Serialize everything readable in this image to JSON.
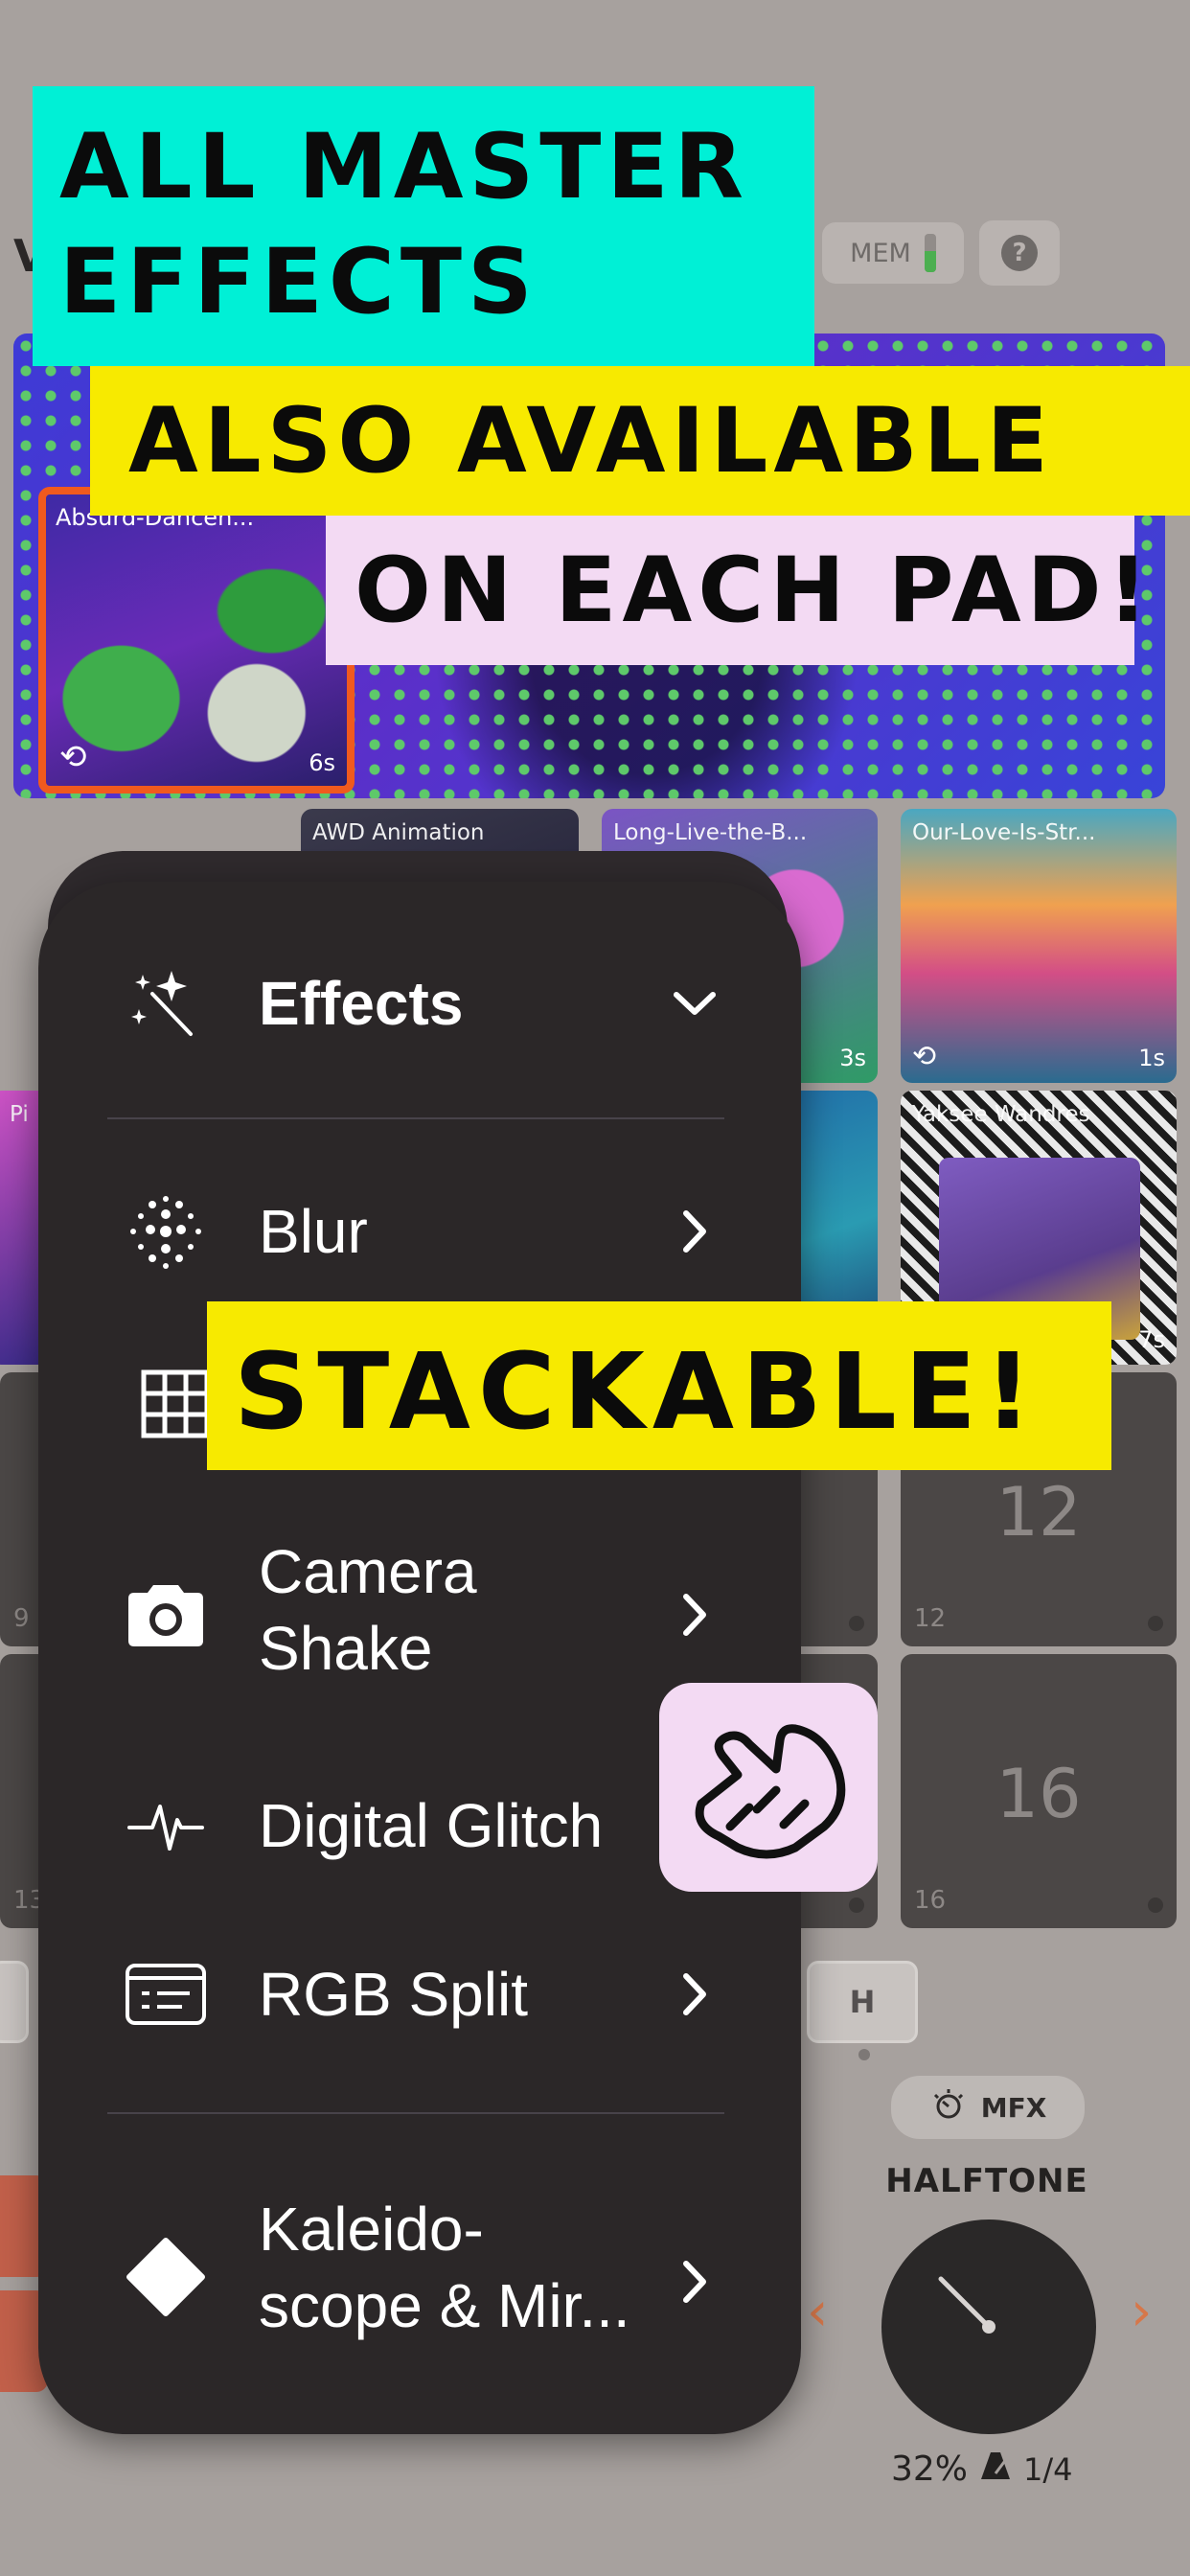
{
  "header": {
    "partial_title": "V",
    "mem_label": "MEM",
    "mem_level": 0.55,
    "help_glyph": "?"
  },
  "preview": {
    "thumb_title": "Absurd-Dancen...",
    "thumb_duration": "6s",
    "loop_icon": "loop-icon"
  },
  "clips": [
    {
      "title": "AWD Animation",
      "duration": ""
    },
    {
      "title": "Long-Live-the-B...",
      "duration": "3s"
    },
    {
      "title": "Our-Love-Is-Str...",
      "duration": "1s"
    },
    {
      "title": "Pi",
      "duration": ""
    },
    {
      "title": "",
      "duration": ""
    },
    {
      "title": "Yaksee Wandres",
      "duration": "7s"
    }
  ],
  "pads": {
    "row1": {
      "left_small": "9",
      "right_big": "12",
      "right_small": "12"
    },
    "row2": {
      "left_small": "13",
      "right_big": "16",
      "right_small": "16"
    }
  },
  "bank_key": "H",
  "mfx": {
    "button_label": "MFX",
    "effect_name": "HALFTONE",
    "percent": "32%",
    "sync_value": "1/4",
    "prev_arrow": "‹",
    "next_arrow": "›"
  },
  "menu": {
    "header_label": "Effects",
    "items": [
      {
        "label": "Blur",
        "icon": "blur-dots-icon"
      },
      {
        "label": "Pixelate",
        "icon": "grid-icon"
      },
      {
        "label": "Camera\nShake",
        "icon": "camera-icon"
      },
      {
        "label": "Digital Glitch",
        "icon": "pulse-icon"
      },
      {
        "label": "RGB Split",
        "icon": "rgb-split-icon"
      },
      {
        "label": "Kaleido-\nscope & Mir...",
        "icon": "diamond-icon"
      }
    ]
  },
  "promo": {
    "line1": "ALL MASTER",
    "line2": "EFFECTS",
    "line3": "ALSO AVAILABLE",
    "line4": "ON EACH PAD!",
    "stackable": "STACKABLE!"
  },
  "colors": {
    "accent_orange": "#f05a1e",
    "banner_cyan": "#00f0d6",
    "banner_yellow": "#f7ea00",
    "banner_pink": "#f3daf3",
    "menu_bg": "#2b2728"
  }
}
